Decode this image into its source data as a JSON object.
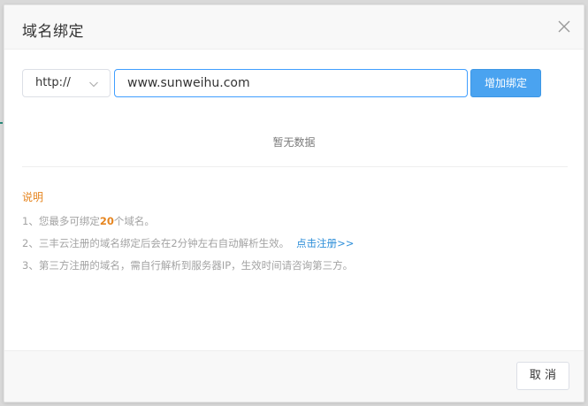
{
  "dialog": {
    "title": "域名绑定"
  },
  "form": {
    "protocol_value": "http://",
    "domain_value": "www.sunweihu.com",
    "add_button_label": "增加绑定"
  },
  "table": {
    "empty_text": "暂无数据"
  },
  "notes": {
    "title": "说明",
    "line1_prefix": "1、您最多可绑定",
    "line1_count": "20",
    "line1_suffix": "个域名。",
    "line2_text": "2、三丰云注册的域名绑定后会在2分钟左右自动解析生效。",
    "line2_link": "点击注册>>",
    "line3_text": "3、第三方注册的域名，需自行解析到服务器IP，生效时间请咨询第三方。"
  },
  "footer": {
    "cancel_label": "取 消"
  },
  "colors": {
    "accent": "#409eff",
    "primary_button": "#4aa3f0",
    "highlight": "#e6851f",
    "link": "#2f8fd9"
  },
  "icons": {
    "close": "close-icon",
    "dropdown": "chevron-down-icon"
  }
}
